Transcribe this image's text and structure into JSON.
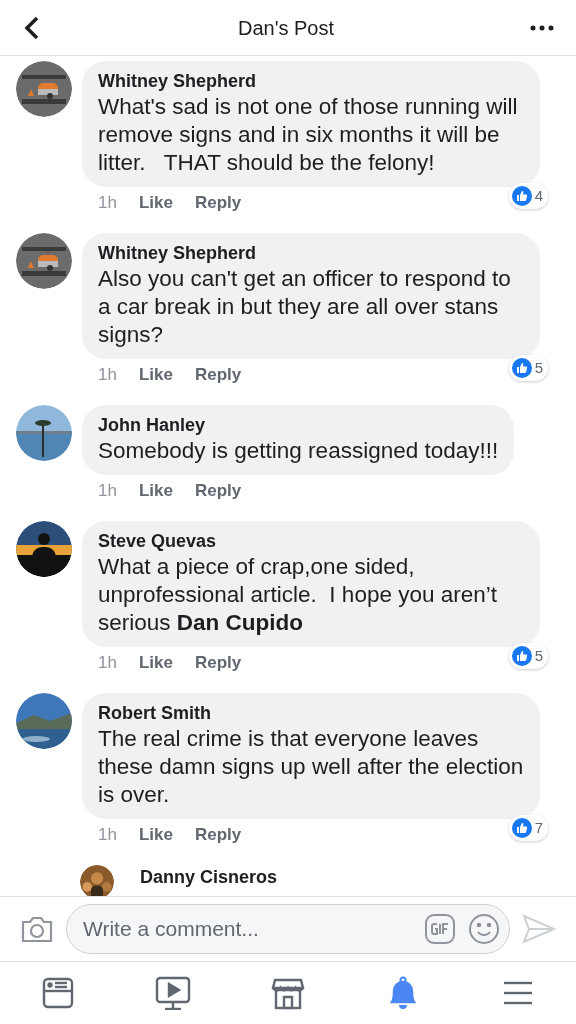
{
  "header": {
    "title": "Dan's Post"
  },
  "comments": [
    {
      "author": "Whitney Shepherd",
      "text": "What's sad is not one of those running will remove signs and in six months it will be litter.   THAT should be the felony!",
      "time": "1h",
      "like": "Like",
      "reply": "Reply",
      "likes": "4",
      "indented": false
    },
    {
      "author": "Whitney Shepherd",
      "text": "Also you can't get an officer to respond to a car break in but they are all over stans signs?",
      "time": "1h",
      "like": "Like",
      "reply": "Reply",
      "likes": "5",
      "indented": false
    },
    {
      "author": "John Hanley",
      "text": "Somebody is getting reassigned today!!!",
      "time": "1h",
      "like": "Like",
      "reply": "Reply",
      "indented": false
    },
    {
      "author": "Steve Quevas",
      "text": "What a piece of crap,one sided, unprofessional article.  I hope you aren’t serious **Dan Cupido**",
      "time": "1h",
      "like": "Like",
      "reply": "Reply",
      "likes": "5",
      "indented": false
    },
    {
      "author": "Robert Smith",
      "text": "The real crime is that everyone leaves these damn signs up well after the election is over.",
      "time": "1h",
      "like": "Like",
      "reply": "Reply",
      "likes": "7",
      "indented": false
    },
    {
      "author": "Danny Cisneros",
      "indented": true
    }
  ],
  "composer": {
    "placeholder": "Write a comment..."
  },
  "nav": [
    {
      "kind": "feed",
      "selected": false
    },
    {
      "kind": "video",
      "selected": false
    },
    {
      "kind": "market",
      "selected": false
    },
    {
      "kind": "bell",
      "selected": true
    },
    {
      "kind": "menu",
      "selected": false
    }
  ]
}
